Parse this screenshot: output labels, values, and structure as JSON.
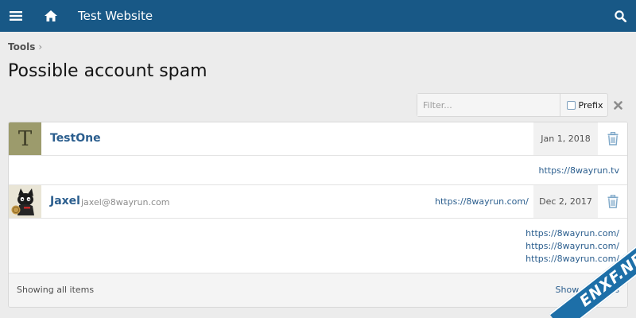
{
  "topbar": {
    "title": "Test Website",
    "menu_icon": "hamburger-menu-icon",
    "home_icon": "home-icon",
    "search_icon": "search-icon",
    "bg_color": "#185886"
  },
  "breadcrumb": {
    "items": [
      "Tools"
    ],
    "separator": "›"
  },
  "page": {
    "title": "Possible account spam"
  },
  "filter": {
    "placeholder": "Filter...",
    "value": "",
    "prefix_label": "Prefix",
    "prefix_checked": false
  },
  "entries": [
    {
      "avatar_letter": "T",
      "username": "TestOne",
      "email": "",
      "row_url": "",
      "date": "Jan 1, 2018",
      "urls": [
        "https://8wayrun.tv"
      ]
    },
    {
      "avatar_letter": "",
      "username": "Jaxel",
      "email": "jaxel@8wayrun.com",
      "row_url": "https://8wayrun.com/",
      "date": "Dec 2, 2017",
      "urls": [
        "https://8wayrun.com/",
        "https://8wayrun.com/",
        "https://8wayrun.com/"
      ]
    }
  ],
  "footer": {
    "status": "Showing all items",
    "show_matches": "Show matches"
  },
  "watermark": {
    "text": "ENXF.NET"
  },
  "colors": {
    "link": "#2b5e8e",
    "accent": "#185886",
    "delete_icon": "#7fa8c9"
  }
}
